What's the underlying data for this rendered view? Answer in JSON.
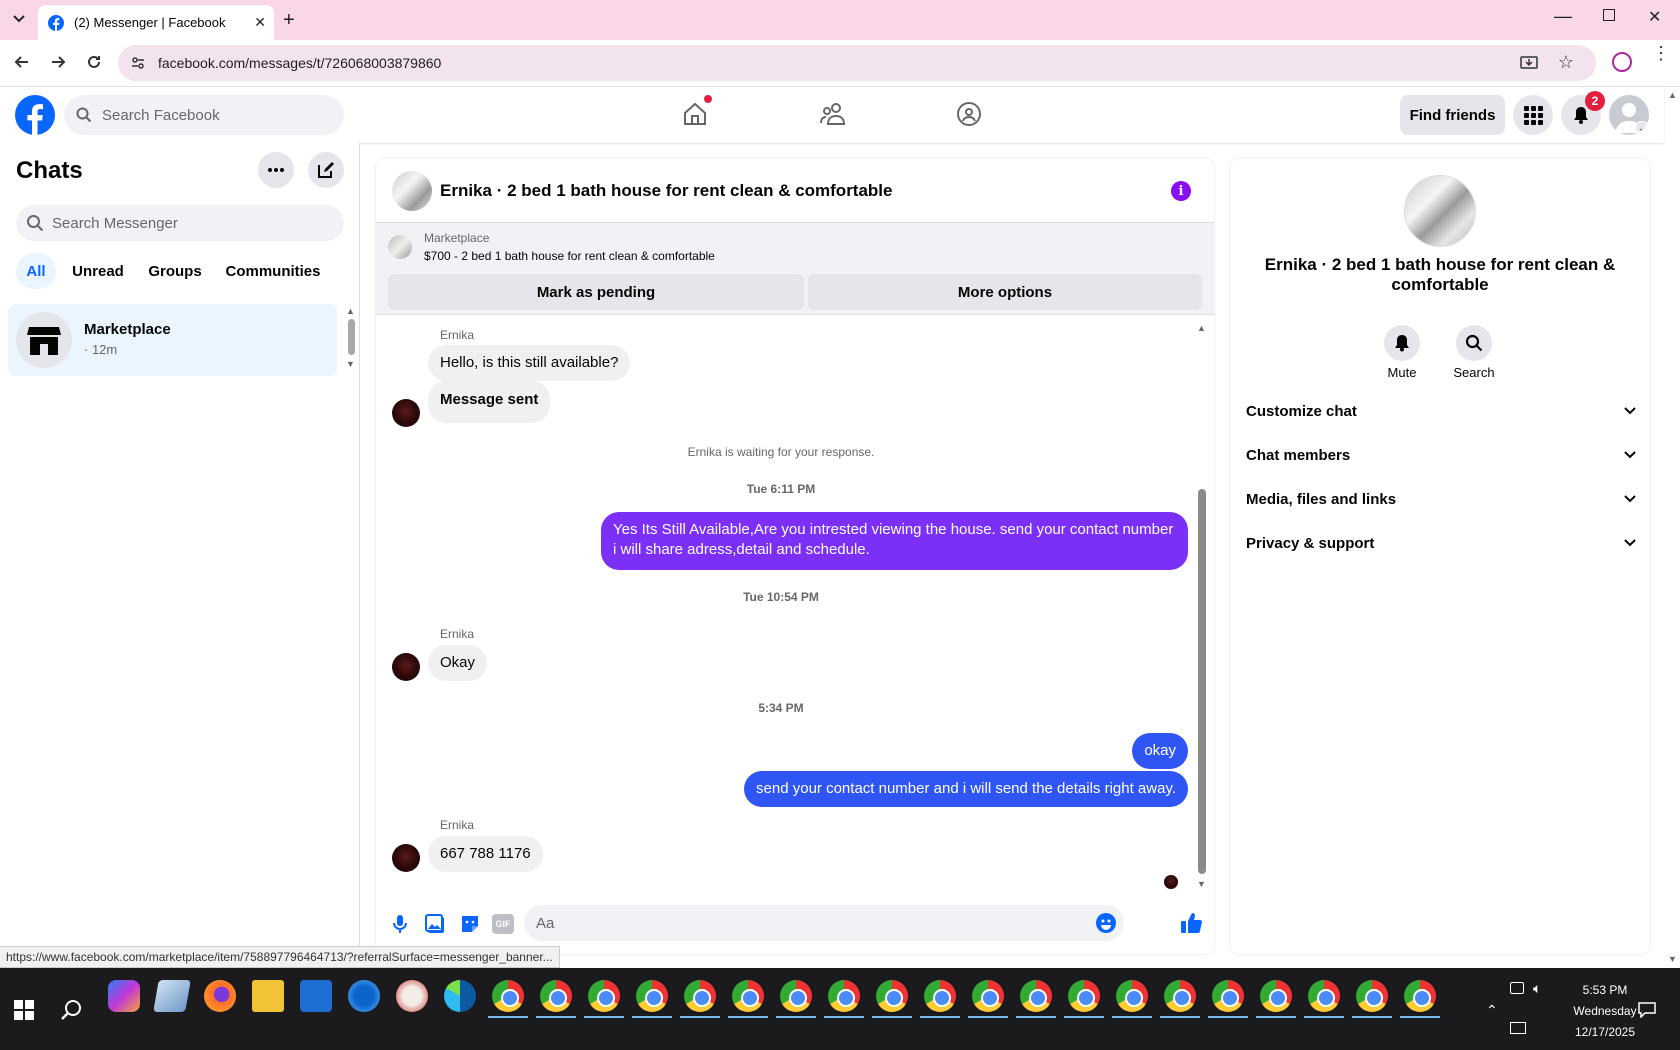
{
  "browser": {
    "tab_title": "(2) Messenger | Facebook",
    "url": "facebook.com/messages/t/726068003879860",
    "status_url": "https://www.facebook.com/marketplace/item/758897796464713/?referralSurface=messenger_banner..."
  },
  "fb_header": {
    "search_placeholder": "Search Facebook",
    "find_friends": "Find friends",
    "notification_count": "2"
  },
  "sidebar": {
    "title": "Chats",
    "search_placeholder": "Search Messenger",
    "filters": [
      "All",
      "Unread",
      "Groups",
      "Communities"
    ],
    "conversation": {
      "name": "Marketplace",
      "meta": "· 12m"
    }
  },
  "chat": {
    "title": "Ernika · 2 bed 1 bath house for rent clean & comfortable",
    "marketplace_label": "Marketplace",
    "listing": "$700 - 2 bed 1 bath house for rent clean & comfortable",
    "mark_pending": "Mark as pending",
    "more_options": "More options",
    "sender": "Ernika",
    "msg1": "Hello, is this still available?",
    "msg2": "Message sent",
    "waiting": "Ernika is waiting for your response.",
    "ts1": "Tue 6:11 PM",
    "out1": "Yes Its Still Available,Are you intrested viewing the house. send your contact number i will share adress,detail and schedule.",
    "ts2": "Tue 10:54 PM",
    "msg3": "Okay",
    "ts3": "5:34 PM",
    "out2": "okay",
    "out3": "send your contact number and i will send the details right away.",
    "msg4": "667 788 1176",
    "composer_placeholder": "Aa"
  },
  "info_panel": {
    "title": "Ernika · 2 bed 1 bath house for rent clean & comfortable",
    "mute": "Mute",
    "search": "Search",
    "sections": [
      "Customize chat",
      "Chat members",
      "Media, files and links",
      "Privacy & support"
    ]
  },
  "taskbar": {
    "time": "5:53 PM",
    "day": "Wednesday",
    "date": "12/17/2025"
  },
  "colors": {
    "fb_blue": "#0866ff",
    "outgoing_purple": "#7b2ff7",
    "outgoing_blue": "#2f55f5",
    "tab_bar_pink": "#f9d7e9"
  }
}
